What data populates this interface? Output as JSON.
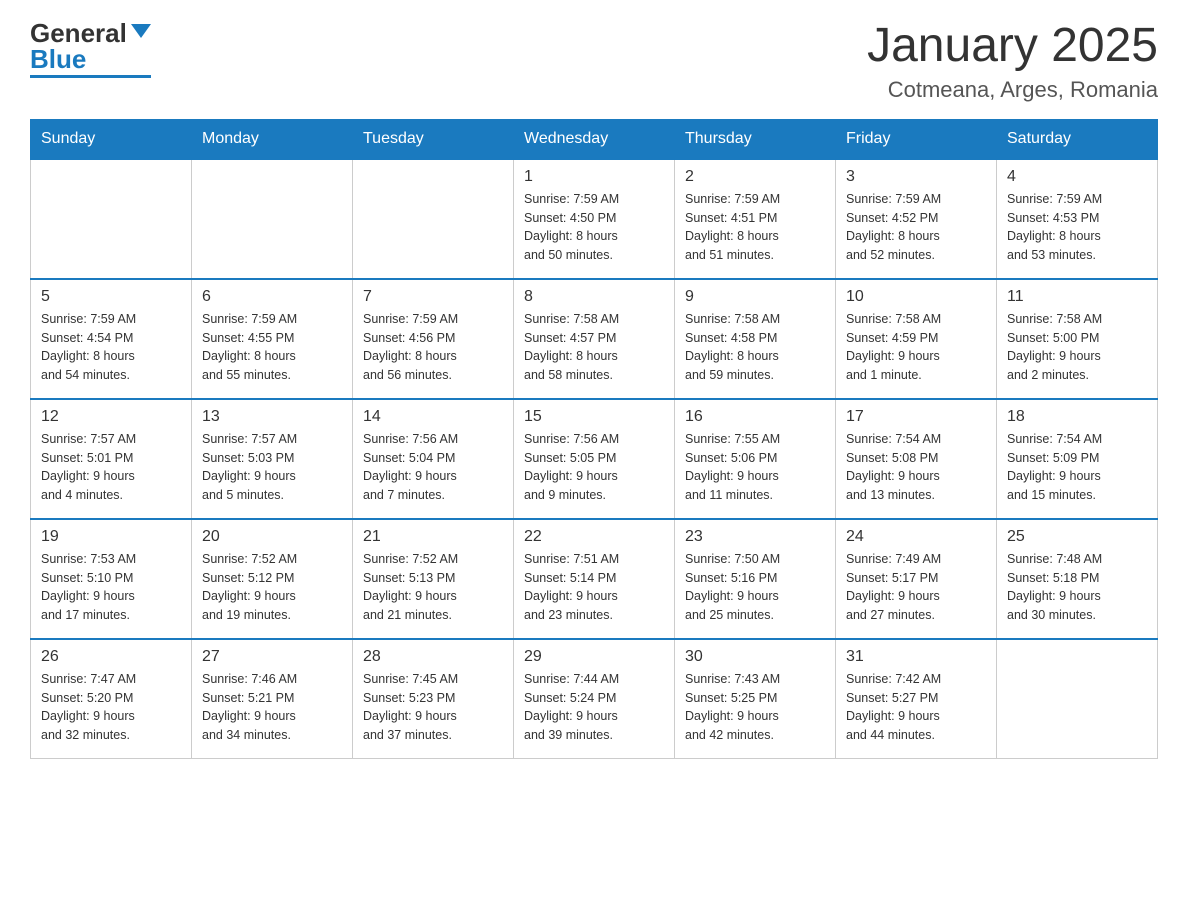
{
  "header": {
    "logo_general": "General",
    "logo_blue": "Blue",
    "title": "January 2025",
    "subtitle": "Cotmeana, Arges, Romania"
  },
  "days_of_week": [
    "Sunday",
    "Monday",
    "Tuesday",
    "Wednesday",
    "Thursday",
    "Friday",
    "Saturday"
  ],
  "weeks": [
    [
      {
        "date": "",
        "info": ""
      },
      {
        "date": "",
        "info": ""
      },
      {
        "date": "",
        "info": ""
      },
      {
        "date": "1",
        "info": "Sunrise: 7:59 AM\nSunset: 4:50 PM\nDaylight: 8 hours\nand 50 minutes."
      },
      {
        "date": "2",
        "info": "Sunrise: 7:59 AM\nSunset: 4:51 PM\nDaylight: 8 hours\nand 51 minutes."
      },
      {
        "date": "3",
        "info": "Sunrise: 7:59 AM\nSunset: 4:52 PM\nDaylight: 8 hours\nand 52 minutes."
      },
      {
        "date": "4",
        "info": "Sunrise: 7:59 AM\nSunset: 4:53 PM\nDaylight: 8 hours\nand 53 minutes."
      }
    ],
    [
      {
        "date": "5",
        "info": "Sunrise: 7:59 AM\nSunset: 4:54 PM\nDaylight: 8 hours\nand 54 minutes."
      },
      {
        "date": "6",
        "info": "Sunrise: 7:59 AM\nSunset: 4:55 PM\nDaylight: 8 hours\nand 55 minutes."
      },
      {
        "date": "7",
        "info": "Sunrise: 7:59 AM\nSunset: 4:56 PM\nDaylight: 8 hours\nand 56 minutes."
      },
      {
        "date": "8",
        "info": "Sunrise: 7:58 AM\nSunset: 4:57 PM\nDaylight: 8 hours\nand 58 minutes."
      },
      {
        "date": "9",
        "info": "Sunrise: 7:58 AM\nSunset: 4:58 PM\nDaylight: 8 hours\nand 59 minutes."
      },
      {
        "date": "10",
        "info": "Sunrise: 7:58 AM\nSunset: 4:59 PM\nDaylight: 9 hours\nand 1 minute."
      },
      {
        "date": "11",
        "info": "Sunrise: 7:58 AM\nSunset: 5:00 PM\nDaylight: 9 hours\nand 2 minutes."
      }
    ],
    [
      {
        "date": "12",
        "info": "Sunrise: 7:57 AM\nSunset: 5:01 PM\nDaylight: 9 hours\nand 4 minutes."
      },
      {
        "date": "13",
        "info": "Sunrise: 7:57 AM\nSunset: 5:03 PM\nDaylight: 9 hours\nand 5 minutes."
      },
      {
        "date": "14",
        "info": "Sunrise: 7:56 AM\nSunset: 5:04 PM\nDaylight: 9 hours\nand 7 minutes."
      },
      {
        "date": "15",
        "info": "Sunrise: 7:56 AM\nSunset: 5:05 PM\nDaylight: 9 hours\nand 9 minutes."
      },
      {
        "date": "16",
        "info": "Sunrise: 7:55 AM\nSunset: 5:06 PM\nDaylight: 9 hours\nand 11 minutes."
      },
      {
        "date": "17",
        "info": "Sunrise: 7:54 AM\nSunset: 5:08 PM\nDaylight: 9 hours\nand 13 minutes."
      },
      {
        "date": "18",
        "info": "Sunrise: 7:54 AM\nSunset: 5:09 PM\nDaylight: 9 hours\nand 15 minutes."
      }
    ],
    [
      {
        "date": "19",
        "info": "Sunrise: 7:53 AM\nSunset: 5:10 PM\nDaylight: 9 hours\nand 17 minutes."
      },
      {
        "date": "20",
        "info": "Sunrise: 7:52 AM\nSunset: 5:12 PM\nDaylight: 9 hours\nand 19 minutes."
      },
      {
        "date": "21",
        "info": "Sunrise: 7:52 AM\nSunset: 5:13 PM\nDaylight: 9 hours\nand 21 minutes."
      },
      {
        "date": "22",
        "info": "Sunrise: 7:51 AM\nSunset: 5:14 PM\nDaylight: 9 hours\nand 23 minutes."
      },
      {
        "date": "23",
        "info": "Sunrise: 7:50 AM\nSunset: 5:16 PM\nDaylight: 9 hours\nand 25 minutes."
      },
      {
        "date": "24",
        "info": "Sunrise: 7:49 AM\nSunset: 5:17 PM\nDaylight: 9 hours\nand 27 minutes."
      },
      {
        "date": "25",
        "info": "Sunrise: 7:48 AM\nSunset: 5:18 PM\nDaylight: 9 hours\nand 30 minutes."
      }
    ],
    [
      {
        "date": "26",
        "info": "Sunrise: 7:47 AM\nSunset: 5:20 PM\nDaylight: 9 hours\nand 32 minutes."
      },
      {
        "date": "27",
        "info": "Sunrise: 7:46 AM\nSunset: 5:21 PM\nDaylight: 9 hours\nand 34 minutes."
      },
      {
        "date": "28",
        "info": "Sunrise: 7:45 AM\nSunset: 5:23 PM\nDaylight: 9 hours\nand 37 minutes."
      },
      {
        "date": "29",
        "info": "Sunrise: 7:44 AM\nSunset: 5:24 PM\nDaylight: 9 hours\nand 39 minutes."
      },
      {
        "date": "30",
        "info": "Sunrise: 7:43 AM\nSunset: 5:25 PM\nDaylight: 9 hours\nand 42 minutes."
      },
      {
        "date": "31",
        "info": "Sunrise: 7:42 AM\nSunset: 5:27 PM\nDaylight: 9 hours\nand 44 minutes."
      },
      {
        "date": "",
        "info": ""
      }
    ]
  ]
}
